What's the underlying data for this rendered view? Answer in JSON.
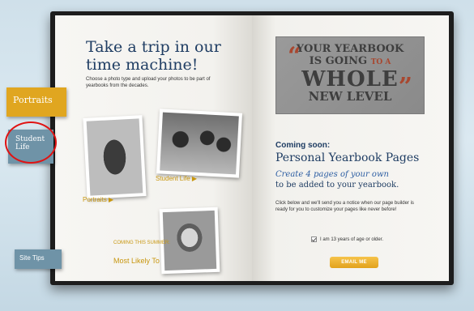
{
  "left_page": {
    "headline": "Take a trip in our time machine!",
    "intro": "Choose a photo type and upload your photos to be part of yearbooks from the decades.",
    "captions": {
      "portraits": "Portraits ▶",
      "student_life": "Student Life ▶",
      "coming_this_summer": "COMING THIS SUMMER:",
      "most_likely_to": "Most Likely To"
    }
  },
  "right_page": {
    "banner": {
      "line1": "YOUR YEARBOOK",
      "line2_a": "IS GOING",
      "line2_b": "TO A",
      "line3": "WHOLE",
      "line4": "NEW LEVEL"
    },
    "coming_soon": "Coming soon:",
    "title": "Personal Yearbook Pages",
    "create": "Create 4 pages of your own",
    "added": "to be added to your yearbook.",
    "notice": "Click below and we'll send you a notice when our page builder is ready for you to customize your pages like never before!",
    "age_label": "I am 13 years of age or older.",
    "email_button": "EMAIL ME"
  },
  "side_tabs": {
    "portraits": "Portraits",
    "student_life": "Student Life",
    "site_tips": "Site Tips"
  },
  "colors": {
    "navy": "#1f3d63",
    "gold": "#e0a620",
    "tab_blue": "#6f93a7",
    "annotation_red": "#e01313"
  }
}
